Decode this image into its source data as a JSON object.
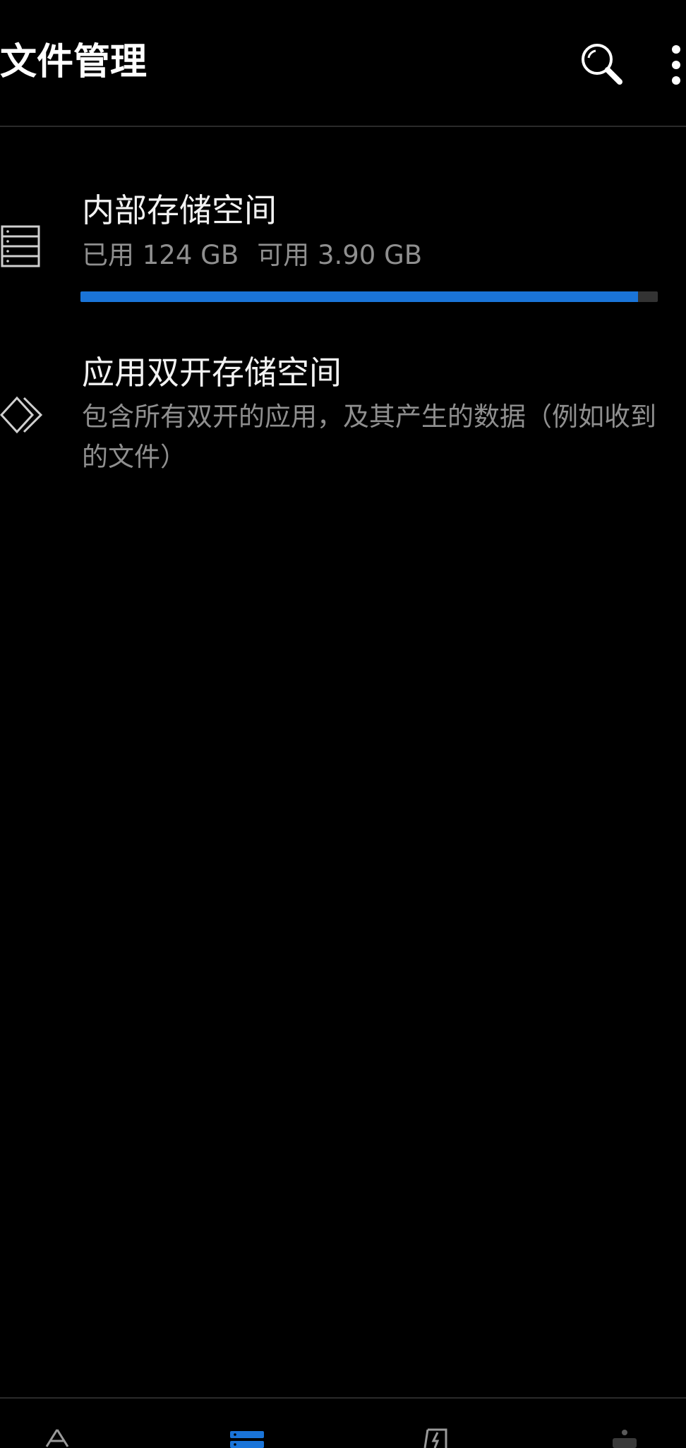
{
  "appbar": {
    "title": "文件管理",
    "search_icon": "search-icon",
    "more_icon": "more-vertical-icon"
  },
  "storage": {
    "internal": {
      "icon": "storage-list-icon",
      "title": "内部存储空间",
      "used_text": "已用 124 GB",
      "free_text": "可用 3.90 GB",
      "usage_fraction": 0.966,
      "bar_color": "#1a74d8",
      "track_color": "#333333"
    },
    "dual_app": {
      "icon": "dual-diamond-icon",
      "title": "应用双开存储空间",
      "description": "包含所有双开的应用，及其产生的数据（例如收到的文件）"
    }
  },
  "bottom_nav": {
    "items": [
      {
        "icon": "recent-icon"
      },
      {
        "icon": "storage-icon",
        "active": true,
        "active_color": "#1a74d8"
      },
      {
        "icon": "clean-icon"
      },
      {
        "icon": "other-icon"
      }
    ]
  }
}
